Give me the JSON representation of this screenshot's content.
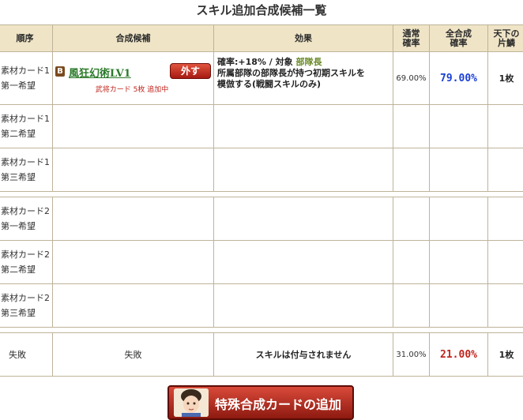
{
  "page_title": "スキル追加合成候補一覧",
  "table": {
    "headers": {
      "order": "順序",
      "candidate": "合成候補",
      "effect": "効果",
      "normal_rate_l1": "通常",
      "normal_rate_l2": "確率",
      "total_rate_l1": "全合成",
      "total_rate_l2": "確率",
      "pieces_l1": "天下の",
      "pieces_l2": "片鱗"
    },
    "rows": [
      {
        "order_l1": "素材カード1",
        "order_l2": "第一希望",
        "badge": "B",
        "skill_name": "風狂幻術LV1",
        "remove_label": "外す",
        "status": "武将カード 5枚 追加中",
        "effect_l1_a": "確率:+18% / 対象 ",
        "effect_target": "部隊長",
        "effect_l2": "所属部隊の部隊長が持つ初期スキルを",
        "effect_l3": "模倣する(戦闘スキルのみ)",
        "normal_rate": "69.00%",
        "total_rate": "79.00%",
        "pieces": "1枚"
      },
      {
        "order_l1": "素材カード1",
        "order_l2": "第二希望"
      },
      {
        "order_l1": "素材カード1",
        "order_l2": "第三希望"
      },
      {
        "order_l1": "素材カード2",
        "order_l2": "第一希望"
      },
      {
        "order_l1": "素材カード2",
        "order_l2": "第二希望"
      },
      {
        "order_l1": "素材カード2",
        "order_l2": "第三希望"
      }
    ],
    "fail_row": {
      "order": "失敗",
      "candidate": "失敗",
      "effect": "スキルは付与されません",
      "normal_rate": "31.00%",
      "total_rate": "21.00%",
      "pieces": "1枚"
    }
  },
  "add_special_button": {
    "label": "特殊合成カードの追加",
    "icon": "character-portrait-icon"
  },
  "colors": {
    "header_bg": "#efe4c6",
    "border": "#bfb39a",
    "blue_rate": "#1a3fd6",
    "red_rate": "#c0241d",
    "skill_link": "#2a7a2a"
  }
}
